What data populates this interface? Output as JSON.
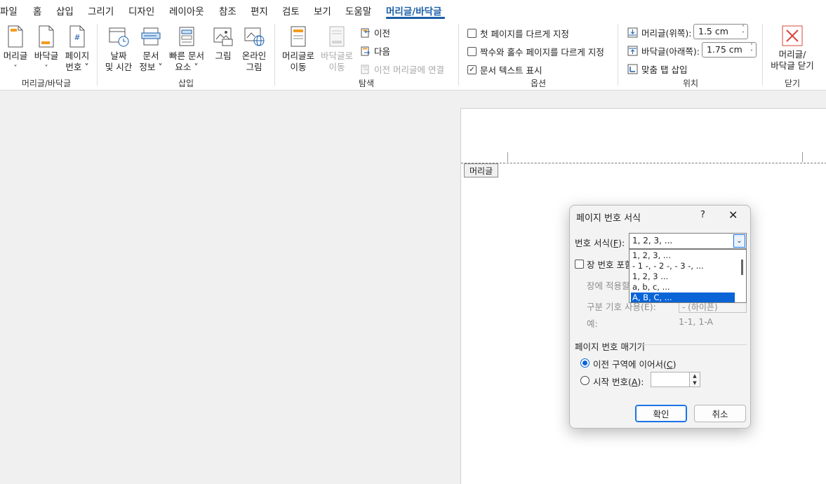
{
  "tabs": [
    {
      "label": "파일",
      "active": false
    },
    {
      "label": "홈",
      "active": false
    },
    {
      "label": "삽입",
      "active": false
    },
    {
      "label": "그리기",
      "active": false
    },
    {
      "label": "디자인",
      "active": false
    },
    {
      "label": "레이아웃",
      "active": false
    },
    {
      "label": "참조",
      "active": false
    },
    {
      "label": "편지",
      "active": false
    },
    {
      "label": "검토",
      "active": false
    },
    {
      "label": "보기",
      "active": false
    },
    {
      "label": "도움말",
      "active": false
    },
    {
      "label": "머리글/바닥글",
      "active": true
    }
  ],
  "ribbon": {
    "hf_group": {
      "label": "머리글/바닥글",
      "header": {
        "line1": "머리글",
        "line2": "˅"
      },
      "footer": {
        "line1": "바닥글",
        "line2": "˅"
      },
      "page_number": {
        "line1": "페이지",
        "line2": "번호 ˅"
      }
    },
    "insert_group": {
      "label": "삽입",
      "datetime": {
        "line1": "날짜",
        "line2": "및 시간"
      },
      "docinfo": {
        "line1": "문서",
        "line2": "정보 ˅"
      },
      "quickparts": {
        "line1": "빠른 문서",
        "line2": "요소 ˅"
      },
      "picture": {
        "line1": "그림"
      },
      "online_picture": {
        "line1": "온라인",
        "line2": "그림"
      }
    },
    "nav_group": {
      "label": "탐색",
      "goto_header": {
        "line1": "머리글로",
        "line2": "이동"
      },
      "goto_footer": {
        "line1": "바닥글로",
        "line2": "이동"
      },
      "previous": "이전",
      "next": "다음",
      "link_previous": "이전 머리글에 연결"
    },
    "options_group": {
      "label": "옵션",
      "first_page": {
        "label": "첫 페이지를 다르게 지정",
        "checked": false
      },
      "odd_even": {
        "label": "짝수와 홀수 페이지를 다르게 지정",
        "checked": false
      },
      "show_text": {
        "label": "문서 텍스트 표시",
        "checked": true
      }
    },
    "position_group": {
      "label": "위치",
      "header_pos": {
        "label": "머리글(위쪽):",
        "value": "1.5 cm"
      },
      "footer_pos": {
        "label": "바닥글(아래쪽):",
        "value": "1.75 cm"
      },
      "align_tab": "맞춤 탭 삽입"
    },
    "close_group": {
      "label": "닫기",
      "close": {
        "line1": "머리글/",
        "line2": "바닥글 닫기"
      }
    }
  },
  "document": {
    "header_tag": "머리글"
  },
  "dialog": {
    "title": "페이지 번호 서식",
    "help": "?",
    "close": "✕",
    "number_format": {
      "label": "번호 서식(",
      "accel": "F",
      "label_end": "):",
      "value": "1, 2, 3, ...",
      "options": [
        "1, 2, 3, ...",
        "- 1 -, - 2 -, - 3 -, ...",
        "1, 2, 3 ...",
        "a, b, c, ...",
        "A, B, C, ..."
      ],
      "selected_index": 4
    },
    "include_chapter": {
      "label": "장 번호 포함",
      "checked": false
    },
    "chapter_style_label": "장에 적용할",
    "separator": {
      "label": "구분 기호 사용(E):",
      "value": "-   (하이픈)"
    },
    "example": {
      "label": "예:",
      "value": "1-1, 1-A"
    },
    "numbering_section": "페이지 번호 매기기",
    "continue": {
      "label": "이전 구역에 이어서(",
      "accel": "C",
      "label_end": ")",
      "checked": true
    },
    "start_at": {
      "label": "시작 번호(",
      "accel": "A",
      "label_end": "):",
      "checked": false,
      "value": ""
    },
    "ok": "확인",
    "cancel": "취소"
  }
}
